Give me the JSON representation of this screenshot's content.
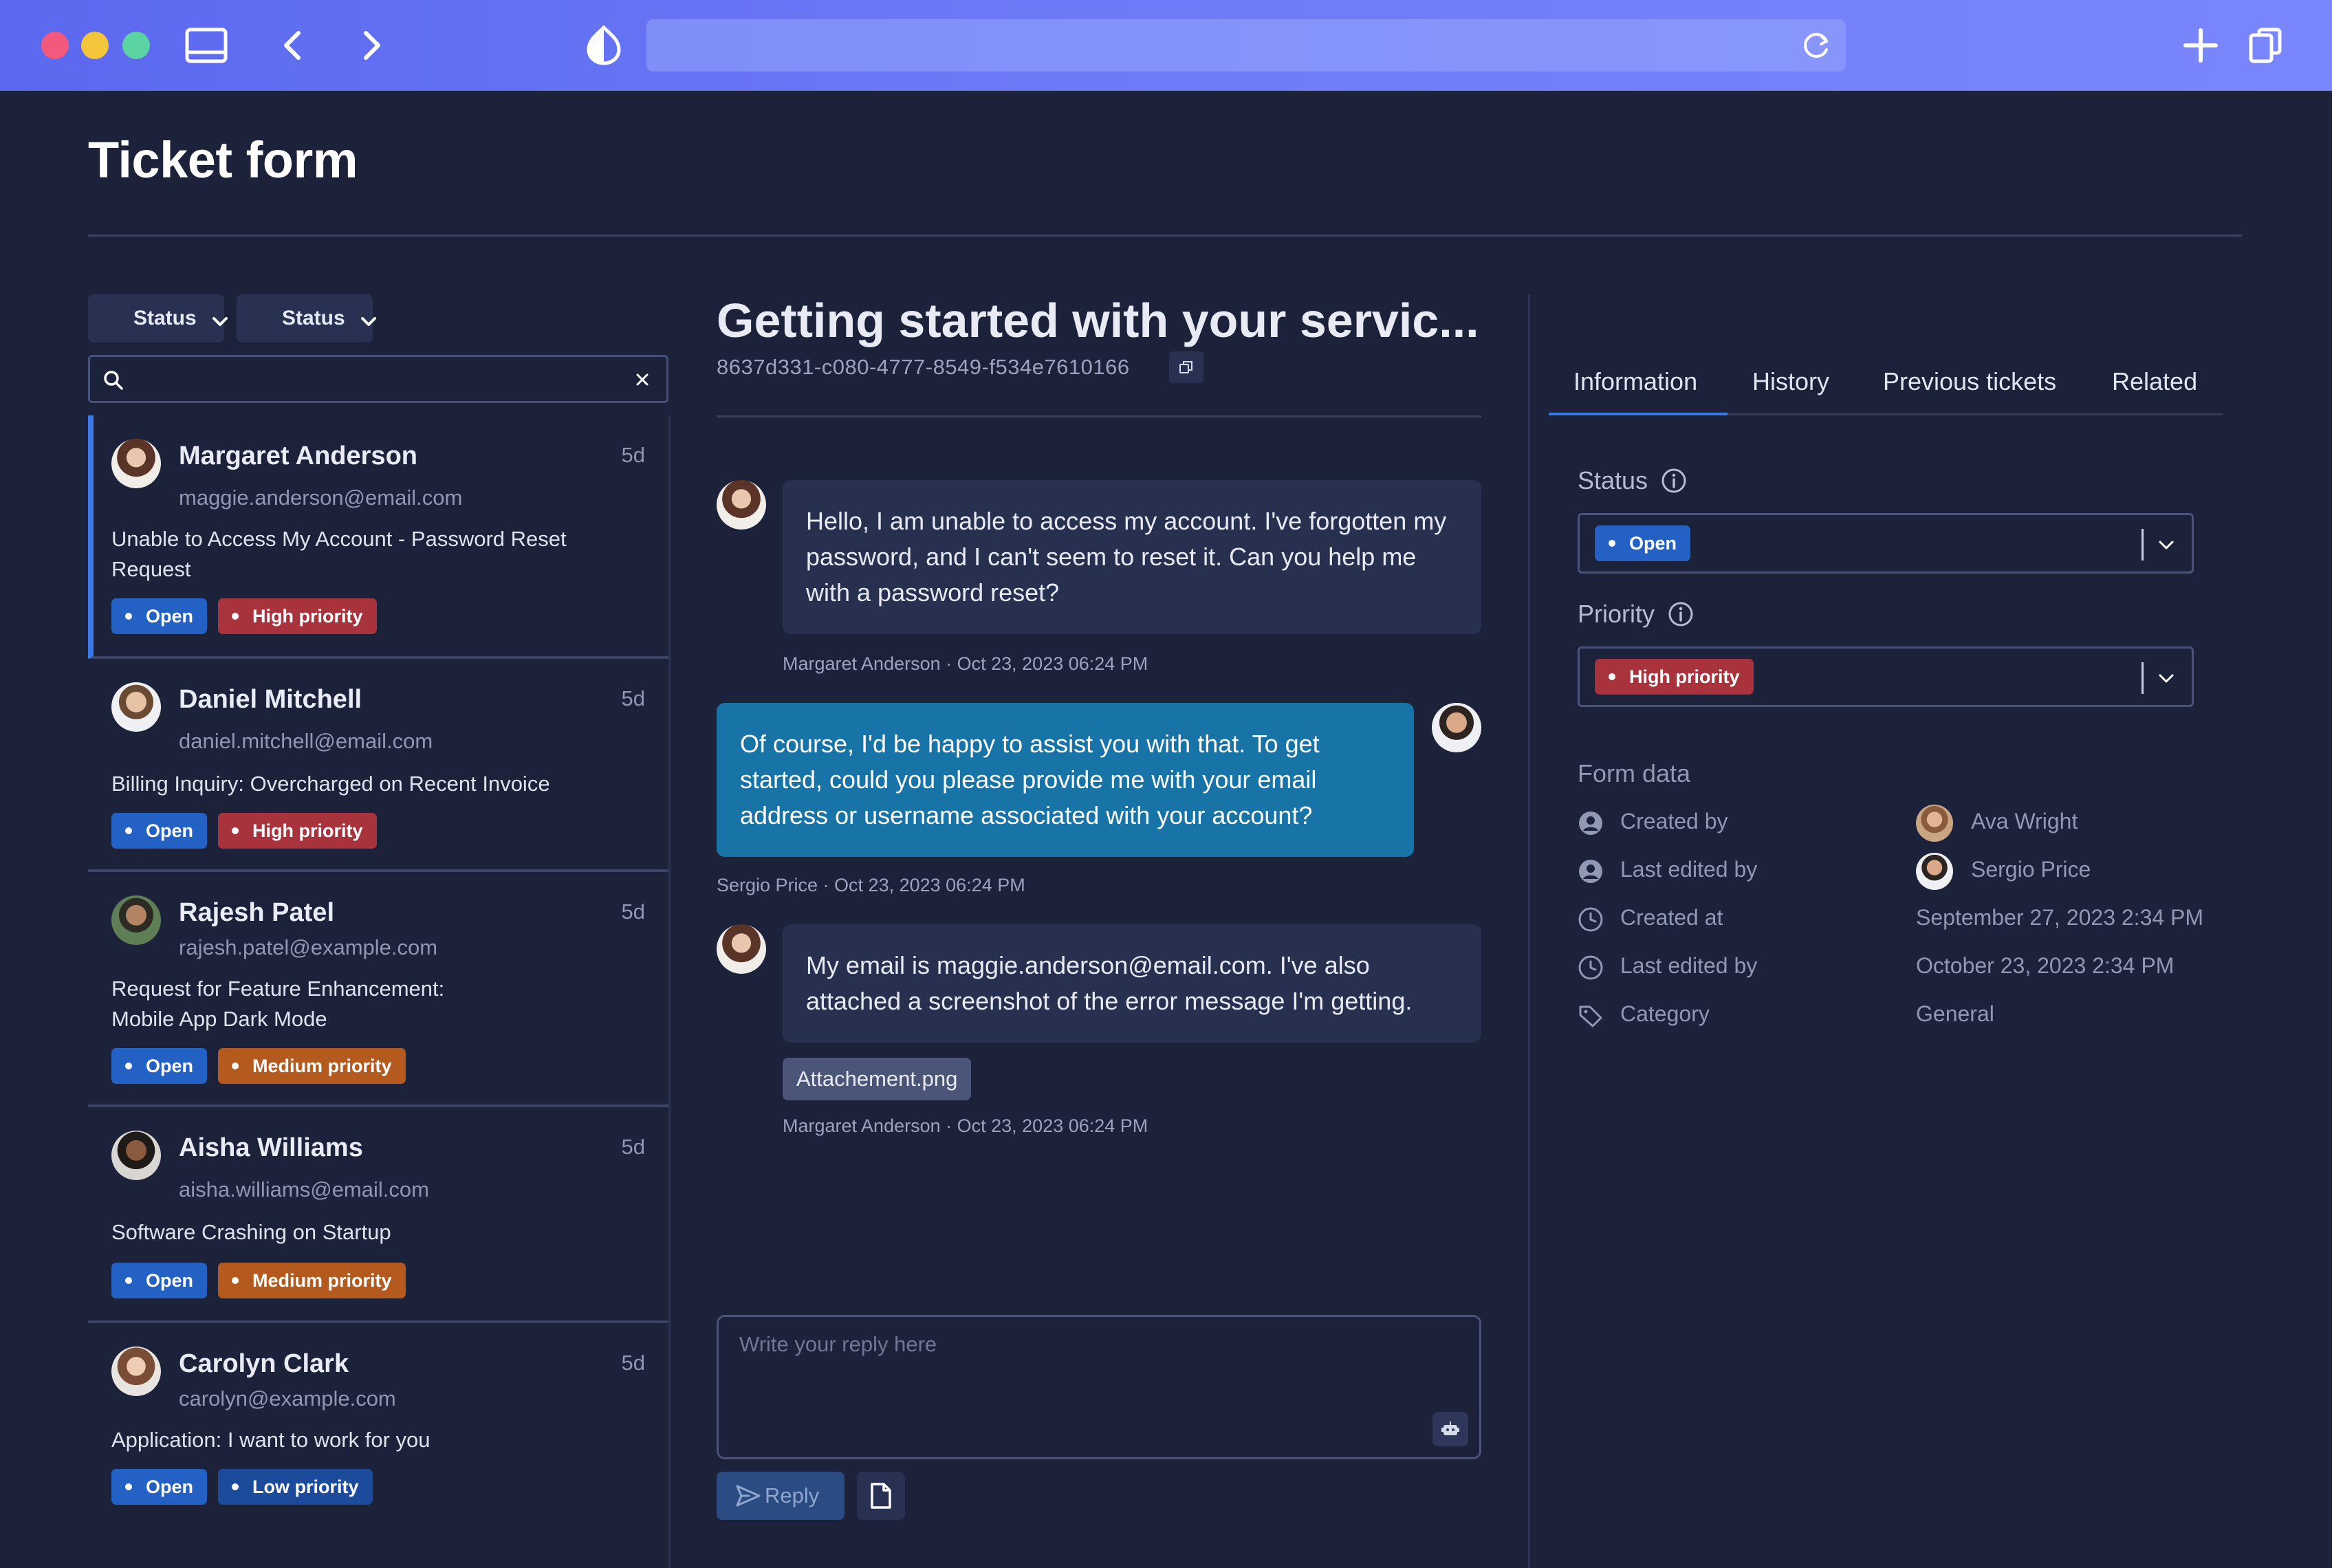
{
  "page": {
    "title": "Ticket form"
  },
  "filters": {
    "status_1": "Status",
    "status_2": "Status"
  },
  "search": {
    "placeholder": "",
    "value": ""
  },
  "tickets": [
    {
      "name": "Margaret Anderson",
      "email": "maggie.anderson@email.com",
      "age": "5d",
      "subject": "Unable to Access My Account - Password Reset Request",
      "status": "Open",
      "priority": "High priority"
    },
    {
      "name": "Daniel Mitchell",
      "email": "daniel.mitchell@email.com",
      "age": "5d",
      "subject": "Billing Inquiry: Overcharged on Recent Invoice",
      "status": "Open",
      "priority": "High priority"
    },
    {
      "name": "Rajesh Patel",
      "email": "rajesh.patel@example.com",
      "age": "5d",
      "subject": "Request for Feature Enhancement: Mobile App Dark Mode",
      "status": "Open",
      "priority": "Medium priority"
    },
    {
      "name": "Aisha Williams",
      "email": "aisha.williams@email.com",
      "age": "5d",
      "subject": "Software Crashing on Startup",
      "status": "Open",
      "priority": "Medium priority"
    },
    {
      "name": "Carolyn Clark",
      "email": "carolyn@example.com",
      "age": "5d",
      "subject": "Application: I want to work for you",
      "status": "Open",
      "priority": "Low priority"
    }
  ],
  "conversation": {
    "title": "Getting started with your servic...",
    "id": "8637d331-c080-4777-8549-f534e7610166",
    "messages": [
      {
        "text": "Hello, I am unable to access my account. I've forgotten my password, and I can't seem to reset it. Can you help me with a password reset?",
        "meta": "Margaret Anderson · Oct 23, 2023 06:24 PM"
      },
      {
        "text": "Of course, I'd be happy to assist you with that. To get started, could you please provide me with your email address or username associated with your account?",
        "meta": "Sergio Price · Oct 23, 2023 06:24 PM"
      },
      {
        "text": "My email is maggie.anderson@email.com. I've also attached a screenshot of the error message I'm getting.",
        "attachment": "Attachement.png",
        "meta": "Margaret Anderson · Oct 23, 2023 06:24 PM"
      }
    ],
    "reply_placeholder": "Write your reply here",
    "reply_label": "Reply"
  },
  "details": {
    "tabs": [
      "Information",
      "History",
      "Previous tickets",
      "Related"
    ],
    "active_tab": "Information",
    "status_label": "Status",
    "status_value": "Open",
    "priority_label": "Priority",
    "priority_value": "High priority",
    "form_data_title": "Form data",
    "form_data": [
      {
        "key": "Created by",
        "value": "Ava Wright"
      },
      {
        "key": "Last edited by",
        "value": "Sergio Price"
      },
      {
        "key": "Created at",
        "value": "September 27, 2023 2:34 PM"
      },
      {
        "key": "Last edited by",
        "value": "October 23, 2023 2:34 PM"
      },
      {
        "key": "Category",
        "value": "General"
      }
    ]
  },
  "colors": {
    "background": "#1b2239",
    "chrome": "#6e7bf8",
    "accent": "#3b78e8",
    "open": "#2461c4",
    "high": "#a8333d",
    "medium": "#b55a1e",
    "low": "#1b4b9a",
    "agent_bubble": "#1873a6"
  }
}
